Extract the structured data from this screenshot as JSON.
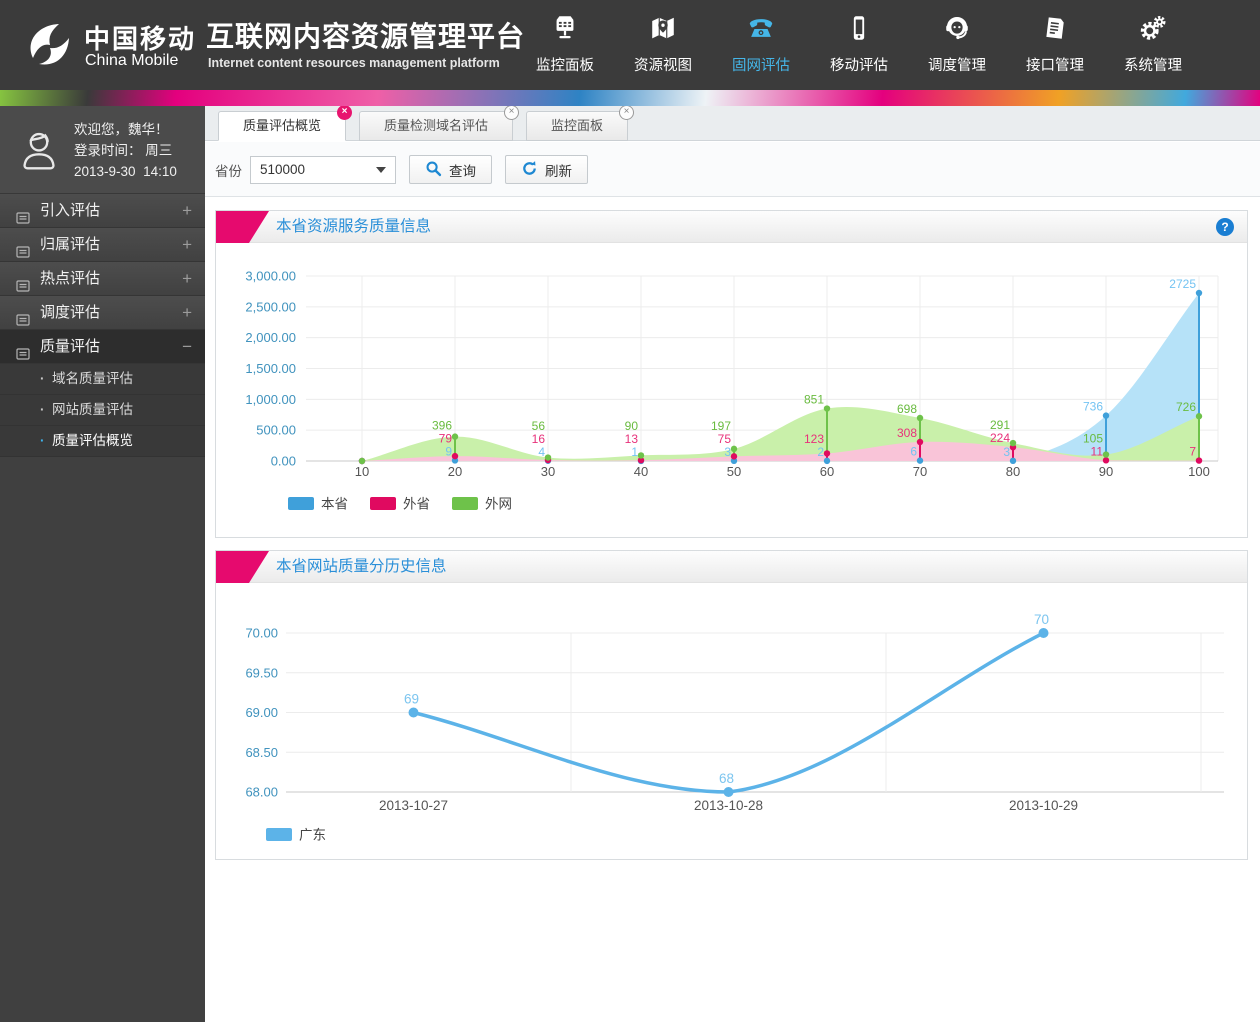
{
  "header": {
    "brand": {
      "name_zh": "中国移动",
      "name_en": "China Mobile"
    },
    "platform": {
      "title_zh": "互联网内容资源管理平台",
      "title_en": "Internet content resources management platform"
    },
    "active_color": "#45b6e8",
    "nav": [
      {
        "id": "monitor-panel",
        "label": "监控面板",
        "icon": "monitor-icon",
        "active": false
      },
      {
        "id": "resource-view",
        "label": "资源视图",
        "icon": "map-icon",
        "active": false
      },
      {
        "id": "fixed-net-eval",
        "label": "固网评估",
        "icon": "telephone-icon",
        "active": true
      },
      {
        "id": "mobile-eval",
        "label": "移动评估",
        "icon": "mobile-icon",
        "active": false
      },
      {
        "id": "dispatch-mgmt",
        "label": "调度管理",
        "icon": "headset-icon",
        "active": false
      },
      {
        "id": "interface-mgmt",
        "label": "接口管理",
        "icon": "document-icon",
        "active": false
      },
      {
        "id": "system-mgmt",
        "label": "系统管理",
        "icon": "gears-icon",
        "active": false
      }
    ]
  },
  "sidebar": {
    "welcome": "欢迎您，魏华！",
    "login_label": "登录时间：",
    "login_day": "周三",
    "login_date": "2013-9-30",
    "login_time": "14:10",
    "menu": [
      {
        "label": "引入评估",
        "glyph": "+",
        "active": false
      },
      {
        "label": "归属评估",
        "glyph": "+",
        "active": false
      },
      {
        "label": "热点评估",
        "glyph": "+",
        "active": false
      },
      {
        "label": "调度评估",
        "glyph": "+",
        "active": false
      },
      {
        "label": "质量评估",
        "glyph": "−",
        "active": true
      }
    ],
    "submenu": [
      {
        "label": "域名质量评估",
        "bullet": "·",
        "active": false
      },
      {
        "label": "网站质量评估",
        "bullet": "·",
        "active": false
      },
      {
        "label": "质量评估概览",
        "bullet": "·",
        "active": true
      }
    ]
  },
  "tabs": [
    {
      "label": "质量评估概览",
      "active": true,
      "close_glyph": "×"
    },
    {
      "label": "质量检测域名评估",
      "active": false,
      "close_glyph": "×"
    },
    {
      "label": "监控面板",
      "active": false,
      "close_glyph": "×"
    }
  ],
  "filter": {
    "province_label": "省份",
    "province_value": "510000",
    "search_label": "查询",
    "refresh_label": "刷新"
  },
  "panels": [
    {
      "title": "本省资源服务质量信息",
      "help_glyph": "?"
    },
    {
      "title": "本省网站质量分历史信息"
    }
  ],
  "chart_data": [
    {
      "type": "area",
      "title": "本省资源服务质量信息",
      "categories": [
        10,
        20,
        30,
        40,
        50,
        60,
        70,
        80,
        90,
        100
      ],
      "ylim": [
        0,
        3000
      ],
      "ytick_step": 500,
      "grid": true,
      "legend_position": "bottom-left",
      "axis_label_color": "#4193be",
      "series": [
        {
          "name": "本省",
          "color": "#3fa0da",
          "fill": "#b6e2f8",
          "label_color": "#74c3f2",
          "values": [
            0,
            9,
            4,
            1,
            3,
            2,
            6,
            3,
            736,
            2725
          ]
        },
        {
          "name": "外省",
          "color": "#e00a60",
          "fill": "#f9c4d8",
          "label_color": "#e8317a",
          "values": [
            0,
            79,
            16,
            13,
            75,
            123,
            308,
            224,
            11,
            7
          ]
        },
        {
          "name": "外网",
          "color": "#6ec24a",
          "fill": "#c9f0aa",
          "label_color": "#69bb3f",
          "values": [
            0,
            396,
            56,
            90,
            197,
            851,
            698,
            291,
            105,
            726
          ]
        }
      ]
    },
    {
      "type": "line",
      "title": "本省网站质量分历史信息",
      "categories": [
        "2013-10-27",
        "2013-10-28",
        "2013-10-29"
      ],
      "ylim": [
        68,
        70
      ],
      "ytick_step": 0.5,
      "grid": true,
      "legend_position": "bottom-left",
      "axis_label_color": "#4193be",
      "series": [
        {
          "name": "广东",
          "color": "#5cb3e8",
          "label_color": "#7cc5ef",
          "values": [
            69,
            68,
            70
          ]
        }
      ]
    }
  ]
}
